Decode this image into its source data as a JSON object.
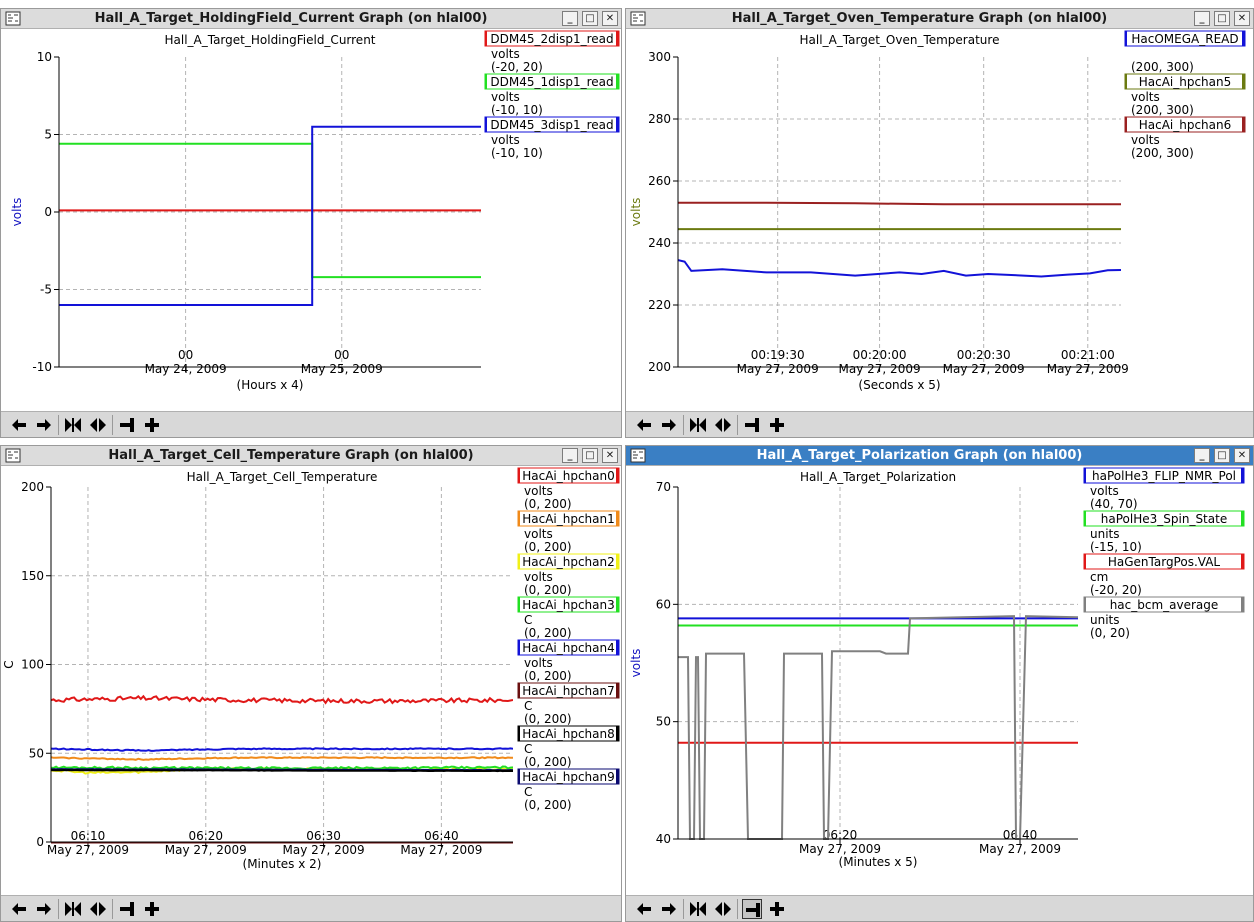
{
  "windows": [
    {
      "id": "w1",
      "title": "Hall_A_Target_HoldingField_Current Graph (on hlal00)",
      "active": false,
      "chart_data": {
        "type": "line",
        "title": "Hall_A_Target_HoldingField_Current",
        "ylabel": "volts",
        "ylabel_color": "#1010c0",
        "xlabel": "(Hours x 4)",
        "ylim": [
          -10,
          10
        ],
        "yticks": [
          "10",
          "5",
          "0",
          "-5",
          "-10"
        ],
        "xlim": [
          0,
          1
        ],
        "xticks": [
          {
            "x": 0.3,
            "time": "00",
            "date": "May 24, 2009"
          },
          {
            "x": 0.67,
            "time": "00",
            "date": "May 25, 2009"
          }
        ],
        "xgrid": [
          0.3,
          0.67
        ],
        "legend": [
          {
            "label": "DDM45_2disp1_read",
            "color": "#e01818",
            "unit": "volts",
            "range": "(-20, 20)"
          },
          {
            "label": "DDM45_1disp1_read",
            "color": "#22e022",
            "unit": "volts",
            "range": "(-10, 10)"
          },
          {
            "label": "DDM45_3disp1_read",
            "color": "#1212d8",
            "unit": "volts",
            "range": "(-10, 10)"
          }
        ],
        "series": [
          {
            "color": "#22e022",
            "points": [
              [
                0,
                4.4
              ],
              [
                0.6,
                4.4
              ],
              [
                0.6,
                -4.2
              ],
              [
                1,
                -4.2
              ]
            ]
          },
          {
            "color": "#e01818",
            "points": [
              [
                0,
                0.1
              ],
              [
                1,
                0.1
              ]
            ]
          },
          {
            "color": "#1212d8",
            "points": [
              [
                0,
                -6.0
              ],
              [
                0.6,
                -6.0
              ],
              [
                0.6,
                5.5
              ],
              [
                1,
                5.5
              ]
            ]
          }
        ]
      }
    },
    {
      "id": "w2",
      "title": "Hall_A_Target_Oven_Temperature Graph (on hlal00)",
      "active": false,
      "chart_data": {
        "type": "line",
        "title": "Hall_A_Target_Oven_Temperature",
        "ylabel": "volts",
        "ylabel_color": "#6b7a10",
        "xlabel": "(Seconds x 5)",
        "ylim": [
          200,
          300
        ],
        "yticks": [
          "300",
          "280",
          "260",
          "240",
          "220",
          "200"
        ],
        "xlim": [
          0,
          1
        ],
        "xticks": [
          {
            "x": 0.225,
            "time": "00:19:30",
            "date": "May 27, 2009"
          },
          {
            "x": 0.455,
            "time": "00:20:00",
            "date": "May 27, 2009"
          },
          {
            "x": 0.69,
            "time": "00:20:30",
            "date": "May 27, 2009"
          },
          {
            "x": 0.925,
            "time": "00:21:00",
            "date": "May 27, 2009"
          }
        ],
        "xgrid": [
          0.225,
          0.455,
          0.69,
          0.925
        ],
        "legend": [
          {
            "label": "HacOMEGA_READ",
            "color": "#1212d8",
            "unit": "",
            "range": "(200, 300)"
          },
          {
            "label": "HacAi_hpchan5",
            "color": "#6b7a10",
            "unit": "volts",
            "range": "(200, 300)"
          },
          {
            "label": "HacAi_hpchan6",
            "color": "#9a2020",
            "unit": "volts",
            "range": "(200, 300)"
          }
        ],
        "series": [
          {
            "color": "#9a2020",
            "points": [
              [
                0,
                253
              ],
              [
                0.2,
                253
              ],
              [
                0.4,
                252.8
              ],
              [
                0.6,
                252.5
              ],
              [
                0.8,
                252.5
              ],
              [
                1,
                252.5
              ]
            ]
          },
          {
            "color": "#6b7a10",
            "points": [
              [
                0,
                244.5
              ],
              [
                1,
                244.5
              ]
            ]
          },
          {
            "color": "#1212d8",
            "points": [
              [
                0,
                234.5
              ],
              [
                0.015,
                234
              ],
              [
                0.03,
                231
              ],
              [
                0.1,
                231.5
              ],
              [
                0.2,
                230.5
              ],
              [
                0.3,
                230.5
              ],
              [
                0.4,
                229.5
              ],
              [
                0.5,
                230.5
              ],
              [
                0.55,
                230
              ],
              [
                0.6,
                231
              ],
              [
                0.65,
                229.5
              ],
              [
                0.7,
                230
              ],
              [
                0.78,
                229.5
              ],
              [
                0.82,
                229.2
              ],
              [
                0.88,
                229.8
              ],
              [
                0.93,
                230.2
              ],
              [
                0.97,
                231.2
              ],
              [
                1,
                231.3
              ]
            ]
          }
        ]
      }
    },
    {
      "id": "w3",
      "title": "Hall_A_Target_Cell_Temperature Graph (on hlal00)",
      "active": false,
      "chart_data": {
        "type": "line",
        "title": "Hall_A_Target_Cell_Temperature",
        "ylabel": "C",
        "ylabel_color": "#000000",
        "xlabel": "(Minutes x 2)",
        "ylim": [
          0,
          200
        ],
        "yticks": [
          "200",
          "150",
          "100",
          "50",
          "0"
        ],
        "xlim": [
          0,
          1
        ],
        "xticks": [
          {
            "x": 0.08,
            "time": "06:10",
            "date": "May 27, 2009"
          },
          {
            "x": 0.335,
            "time": "06:20",
            "date": "May 27, 2009"
          },
          {
            "x": 0.59,
            "time": "06:30",
            "date": "May 27, 2009"
          },
          {
            "x": 0.845,
            "time": "06:40",
            "date": "May 27, 2009"
          }
        ],
        "xgrid": [
          0.08,
          0.335,
          0.59,
          0.845
        ],
        "legend": [
          {
            "label": "HacAi_hpchan0",
            "color": "#e01818",
            "unit": "volts",
            "range": "(0, 200)"
          },
          {
            "label": "HacAi_hpchan1",
            "color": "#f08a1a",
            "unit": "volts",
            "range": "(0, 200)"
          },
          {
            "label": "HacAi_hpchan2",
            "color": "#f0f018",
            "unit": "volts",
            "range": "(0, 200)"
          },
          {
            "label": "HacAi_hpchan3",
            "color": "#22e022",
            "unit": "C",
            "range": "(0, 200)"
          },
          {
            "label": "HacAi_hpchan4",
            "color": "#1212d8",
            "unit": "volts",
            "range": "(0, 200)"
          },
          {
            "label": "HacAi_hpchan7",
            "color": "#6a1010",
            "unit": "C",
            "range": "(0, 200)"
          },
          {
            "label": "HacAi_hpchan8",
            "color": "#000000",
            "unit": "C",
            "range": "(0, 200)"
          },
          {
            "label": "HacAi_hpchan9",
            "color": "#0a0a70",
            "unit": "C",
            "range": "(0, 200)"
          }
        ],
        "series": [
          {
            "color": "#e01818",
            "noise": 1.2,
            "points": [
              [
                0,
                80
              ],
              [
                0.2,
                81
              ],
              [
                0.4,
                80
              ],
              [
                0.6,
                79.5
              ],
              [
                0.8,
                79.5
              ],
              [
                1,
                80
              ]
            ]
          },
          {
            "color": "#1212d8",
            "noise": 0.3,
            "points": [
              [
                0,
                52.5
              ],
              [
                0.2,
                51.5
              ],
              [
                0.4,
                52.5
              ],
              [
                0.6,
                52.5
              ],
              [
                0.8,
                52.5
              ],
              [
                1,
                52.5
              ]
            ]
          },
          {
            "color": "#f08a1a",
            "noise": 0.3,
            "points": [
              [
                0,
                47.5
              ],
              [
                0.2,
                46.5
              ],
              [
                0.4,
                47.5
              ],
              [
                0.6,
                47.5
              ],
              [
                1,
                47.5
              ]
            ]
          },
          {
            "color": "#f0f018",
            "noise": 0.6,
            "points": [
              [
                0,
                40.5
              ],
              [
                0.08,
                39
              ],
              [
                0.2,
                39.5
              ],
              [
                0.3,
                41
              ],
              [
                0.6,
                41
              ],
              [
                1,
                41
              ]
            ]
          },
          {
            "color": "#22e022",
            "noise": 0.6,
            "points": [
              [
                0,
                42
              ],
              [
                0.5,
                41.5
              ],
              [
                1,
                42
              ]
            ]
          },
          {
            "color": "#0a0a70",
            "noise": 0.1,
            "points": [
              [
                0,
                41
              ],
              [
                1,
                40.5
              ]
            ]
          },
          {
            "color": "#000000",
            "noise": 0.1,
            "points": [
              [
                0,
                40.5
              ],
              [
                1,
                40
              ]
            ]
          },
          {
            "color": "#6a1010",
            "noise": 0,
            "points": [
              [
                0,
                -0.3
              ],
              [
                1,
                -0.3
              ]
            ]
          }
        ]
      }
    },
    {
      "id": "w4",
      "title": "Hall_A_Target_Polarization Graph (on hlal00)",
      "active": true,
      "chart_data": {
        "type": "line",
        "title": "Hall_A_Target_Polarization",
        "ylabel": "volts",
        "ylabel_color": "#1010c0",
        "xlabel": "(Minutes x 5)",
        "ylim": [
          40,
          70
        ],
        "yticks": [
          "70",
          "60",
          "50",
          "40"
        ],
        "xlim": [
          0,
          1
        ],
        "xticks": [
          {
            "x": 0.405,
            "time": "06:20",
            "date": "May 27, 2009"
          },
          {
            "x": 0.855,
            "time": "06:40",
            "date": "May 27, 2009"
          }
        ],
        "xgrid": [
          0.405,
          0.855
        ],
        "legend": [
          {
            "label": "haPolHe3_FLIP_NMR_Pol",
            "color": "#1212d8",
            "unit": "volts",
            "range": "(40, 70)"
          },
          {
            "label": "haPolHe3_Spin_State",
            "color": "#22e022",
            "unit": "units",
            "range": "(-15, 10)"
          },
          {
            "label": "HaGenTargPos.VAL",
            "color": "#e01818",
            "unit": "cm",
            "range": "(-20, 20)"
          },
          {
            "label": "hac_bcm_average",
            "color": "#808080",
            "unit": "units",
            "range": "(0, 20)"
          }
        ],
        "series": [
          {
            "color": "#1212d8",
            "points": [
              [
                0,
                58.8
              ],
              [
                1,
                58.8
              ]
            ]
          },
          {
            "color": "#22e022",
            "points": [
              [
                0,
                58.2
              ],
              [
                1,
                58.2
              ]
            ]
          },
          {
            "color": "#e01818",
            "points": [
              [
                0,
                48.2
              ],
              [
                1,
                48.2
              ]
            ]
          },
          {
            "color": "#808080",
            "points": [
              [
                0,
                55.5
              ],
              [
                0.025,
                55.5
              ],
              [
                0.03,
                40
              ],
              [
                0.04,
                40
              ],
              [
                0.045,
                55.5
              ],
              [
                0.05,
                55.5
              ],
              [
                0.055,
                40
              ],
              [
                0.065,
                40
              ],
              [
                0.07,
                55.8
              ],
              [
                0.165,
                55.8
              ],
              [
                0.175,
                40
              ],
              [
                0.26,
                40
              ],
              [
                0.265,
                55.8
              ],
              [
                0.36,
                55.8
              ],
              [
                0.365,
                40
              ],
              [
                0.375,
                40
              ],
              [
                0.385,
                56
              ],
              [
                0.505,
                56
              ],
              [
                0.52,
                55.8
              ],
              [
                0.575,
                55.8
              ],
              [
                0.58,
                58.8
              ],
              [
                0.84,
                59
              ],
              [
                0.845,
                40
              ],
              [
                0.855,
                40
              ],
              [
                0.87,
                59
              ],
              [
                1,
                58.9
              ]
            ]
          }
        ]
      }
    }
  ],
  "toolbar_icons": [
    "scroll-left-icon",
    "scroll-right-icon",
    "zoom-in-x-icon",
    "zoom-out-x-icon",
    "zoom-y-icon",
    "add-pv-icon"
  ]
}
